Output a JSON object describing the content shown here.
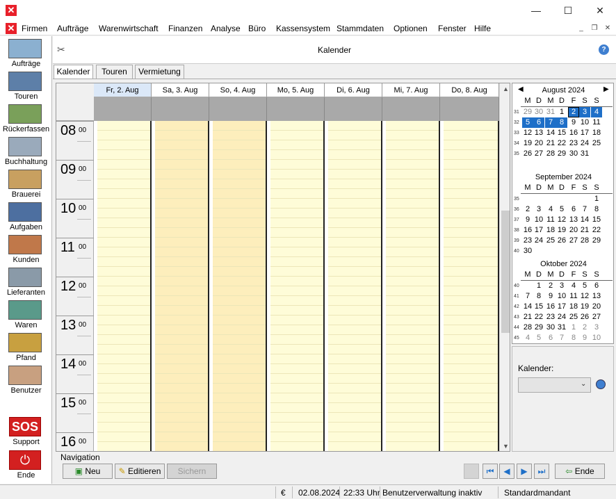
{
  "app": {
    "title": "",
    "icon": "app-logo-icon"
  },
  "menu": [
    "Firmen",
    "Aufträge",
    "Warenwirtschaft",
    "Finanzen",
    "Analyse",
    "Büro",
    "Kassensystem",
    "Stammdaten",
    "Optionen",
    "Fenster",
    "Hilfe"
  ],
  "sidebar": [
    {
      "label": "Aufträge",
      "icon": "orders-icon"
    },
    {
      "label": "Touren",
      "icon": "truck-icon"
    },
    {
      "label": "Rückerfassen",
      "icon": "return-icon"
    },
    {
      "label": "Buchhaltung",
      "icon": "accounting-icon"
    },
    {
      "label": "Brauerei",
      "icon": "brewery-icon"
    },
    {
      "label": "Aufgaben",
      "icon": "tasks-icon"
    },
    {
      "label": "Kunden",
      "icon": "customers-icon"
    },
    {
      "label": "Lieferanten",
      "icon": "suppliers-icon"
    },
    {
      "label": "Waren",
      "icon": "goods-icon"
    },
    {
      "label": "Pfand",
      "icon": "deposit-icon"
    },
    {
      "label": "Benutzer",
      "icon": "user-icon"
    }
  ],
  "sidebar_bottom": [
    {
      "label": "Support",
      "icon": "sos-icon",
      "icon_text": "SOS"
    },
    {
      "label": "Ende",
      "icon": "power-icon"
    }
  ],
  "header": {
    "title": "Kalender"
  },
  "tabs": [
    {
      "label": "Kalender",
      "active": true
    },
    {
      "label": "Touren",
      "active": false
    },
    {
      "label": "Vermietung",
      "active": false
    }
  ],
  "days": [
    {
      "label": "Fr, 2. Aug",
      "selected": true,
      "weekend": false
    },
    {
      "label": "Sa, 3. Aug",
      "selected": false,
      "weekend": true
    },
    {
      "label": "So, 4. Aug",
      "selected": false,
      "weekend": true
    },
    {
      "label": "Mo, 5. Aug",
      "selected": false,
      "weekend": false
    },
    {
      "label": "Di, 6. Aug",
      "selected": false,
      "weekend": false
    },
    {
      "label": "Mi, 7. Aug",
      "selected": false,
      "weekend": false
    },
    {
      "label": "Do, 8. Aug",
      "selected": false,
      "weekend": false
    }
  ],
  "hours": [
    {
      "h": "08",
      "m": "00"
    },
    {
      "h": "09",
      "m": "00"
    },
    {
      "h": "10",
      "m": "00"
    },
    {
      "h": "11",
      "m": "00"
    },
    {
      "h": "12",
      "m": "00"
    },
    {
      "h": "13",
      "m": "00"
    },
    {
      "h": "14",
      "m": "00"
    },
    {
      "h": "15",
      "m": "00"
    },
    {
      "h": "16",
      "m": "00"
    }
  ],
  "weekday_headers": [
    "M",
    "D",
    "M",
    "D",
    "F",
    "S",
    "S"
  ],
  "months": [
    {
      "title": "August 2024",
      "weeks": [
        {
          "wk": "31",
          "days": [
            {
              "d": "29",
              "g": 1
            },
            {
              "d": "30",
              "g": 1
            },
            {
              "d": "31",
              "g": 1
            },
            {
              "d": "1"
            },
            {
              "d": "2",
              "sel": 1,
              "today": 1
            },
            {
              "d": "3",
              "sel": 1
            },
            {
              "d": "4",
              "sel": 1
            }
          ]
        },
        {
          "wk": "32",
          "days": [
            {
              "d": "5",
              "sel": 1
            },
            {
              "d": "6",
              "sel": 1
            },
            {
              "d": "7",
              "sel": 1
            },
            {
              "d": "8",
              "sel": 1
            },
            {
              "d": "9"
            },
            {
              "d": "10"
            },
            {
              "d": "11"
            }
          ]
        },
        {
          "wk": "33",
          "days": [
            {
              "d": "12"
            },
            {
              "d": "13"
            },
            {
              "d": "14"
            },
            {
              "d": "15"
            },
            {
              "d": "16"
            },
            {
              "d": "17"
            },
            {
              "d": "18"
            }
          ]
        },
        {
          "wk": "34",
          "days": [
            {
              "d": "19"
            },
            {
              "d": "20"
            },
            {
              "d": "21"
            },
            {
              "d": "22"
            },
            {
              "d": "23"
            },
            {
              "d": "24"
            },
            {
              "d": "25"
            }
          ]
        },
        {
          "wk": "35",
          "days": [
            {
              "d": "26"
            },
            {
              "d": "27"
            },
            {
              "d": "28"
            },
            {
              "d": "29"
            },
            {
              "d": "30"
            },
            {
              "d": "31"
            },
            {
              "d": ""
            }
          ]
        }
      ]
    },
    {
      "title": "September 2024",
      "weeks": [
        {
          "wk": "35",
          "days": [
            {
              "d": ""
            },
            {
              "d": ""
            },
            {
              "d": ""
            },
            {
              "d": ""
            },
            {
              "d": ""
            },
            {
              "d": ""
            },
            {
              "d": "1"
            }
          ]
        },
        {
          "wk": "36",
          "days": [
            {
              "d": "2"
            },
            {
              "d": "3"
            },
            {
              "d": "4"
            },
            {
              "d": "5"
            },
            {
              "d": "6"
            },
            {
              "d": "7"
            },
            {
              "d": "8"
            }
          ]
        },
        {
          "wk": "37",
          "days": [
            {
              "d": "9"
            },
            {
              "d": "10"
            },
            {
              "d": "11"
            },
            {
              "d": "12"
            },
            {
              "d": "13"
            },
            {
              "d": "14"
            },
            {
              "d": "15"
            }
          ]
        },
        {
          "wk": "38",
          "days": [
            {
              "d": "16"
            },
            {
              "d": "17"
            },
            {
              "d": "18"
            },
            {
              "d": "19"
            },
            {
              "d": "20"
            },
            {
              "d": "21"
            },
            {
              "d": "22"
            }
          ]
        },
        {
          "wk": "39",
          "days": [
            {
              "d": "23"
            },
            {
              "d": "24"
            },
            {
              "d": "25"
            },
            {
              "d": "26"
            },
            {
              "d": "27"
            },
            {
              "d": "28"
            },
            {
              "d": "29"
            }
          ]
        },
        {
          "wk": "40",
          "days": [
            {
              "d": "30"
            },
            {
              "d": ""
            },
            {
              "d": ""
            },
            {
              "d": ""
            },
            {
              "d": ""
            },
            {
              "d": ""
            },
            {
              "d": ""
            }
          ]
        }
      ]
    },
    {
      "title": "Oktober 2024",
      "weeks": [
        {
          "wk": "40",
          "days": [
            {
              "d": ""
            },
            {
              "d": "1"
            },
            {
              "d": "2"
            },
            {
              "d": "3"
            },
            {
              "d": "4"
            },
            {
              "d": "5"
            },
            {
              "d": "6"
            }
          ]
        },
        {
          "wk": "41",
          "days": [
            {
              "d": "7"
            },
            {
              "d": "8"
            },
            {
              "d": "9"
            },
            {
              "d": "10"
            },
            {
              "d": "11"
            },
            {
              "d": "12"
            },
            {
              "d": "13"
            }
          ]
        },
        {
          "wk": "42",
          "days": [
            {
              "d": "14"
            },
            {
              "d": "15"
            },
            {
              "d": "16"
            },
            {
              "d": "17"
            },
            {
              "d": "18"
            },
            {
              "d": "19"
            },
            {
              "d": "20"
            }
          ]
        },
        {
          "wk": "43",
          "days": [
            {
              "d": "21"
            },
            {
              "d": "22"
            },
            {
              "d": "23"
            },
            {
              "d": "24"
            },
            {
              "d": "25"
            },
            {
              "d": "26"
            },
            {
              "d": "27"
            }
          ]
        },
        {
          "wk": "44",
          "days": [
            {
              "d": "28"
            },
            {
              "d": "29"
            },
            {
              "d": "30"
            },
            {
              "d": "31"
            },
            {
              "d": "1",
              "g": 1
            },
            {
              "d": "2",
              "g": 1
            },
            {
              "d": "3",
              "g": 1
            }
          ]
        },
        {
          "wk": "45",
          "days": [
            {
              "d": "4",
              "g": 1
            },
            {
              "d": "5",
              "g": 1
            },
            {
              "d": "6",
              "g": 1
            },
            {
              "d": "7",
              "g": 1
            },
            {
              "d": "8",
              "g": 1
            },
            {
              "d": "9",
              "g": 1
            },
            {
              "d": "10",
              "g": 1
            }
          ]
        }
      ]
    }
  ],
  "calendar_select": {
    "label": "Kalender:",
    "value": ""
  },
  "navigation": {
    "label": "Navigation",
    "new": "Neu",
    "edit": "Editieren",
    "save": "Sichern",
    "end": "Ende"
  },
  "status": {
    "currency": "€",
    "date": "02.08.2024",
    "time": "22:33 Uhr",
    "user_admin": "Benutzerverwaltung inaktiv",
    "mandant": "Standardmandant"
  },
  "colors": {
    "accent": "#1e6fc8",
    "weekday_bg": "#fefcd8",
    "weekend_bg": "#fdeebc",
    "brand_red": "#e8202a"
  }
}
